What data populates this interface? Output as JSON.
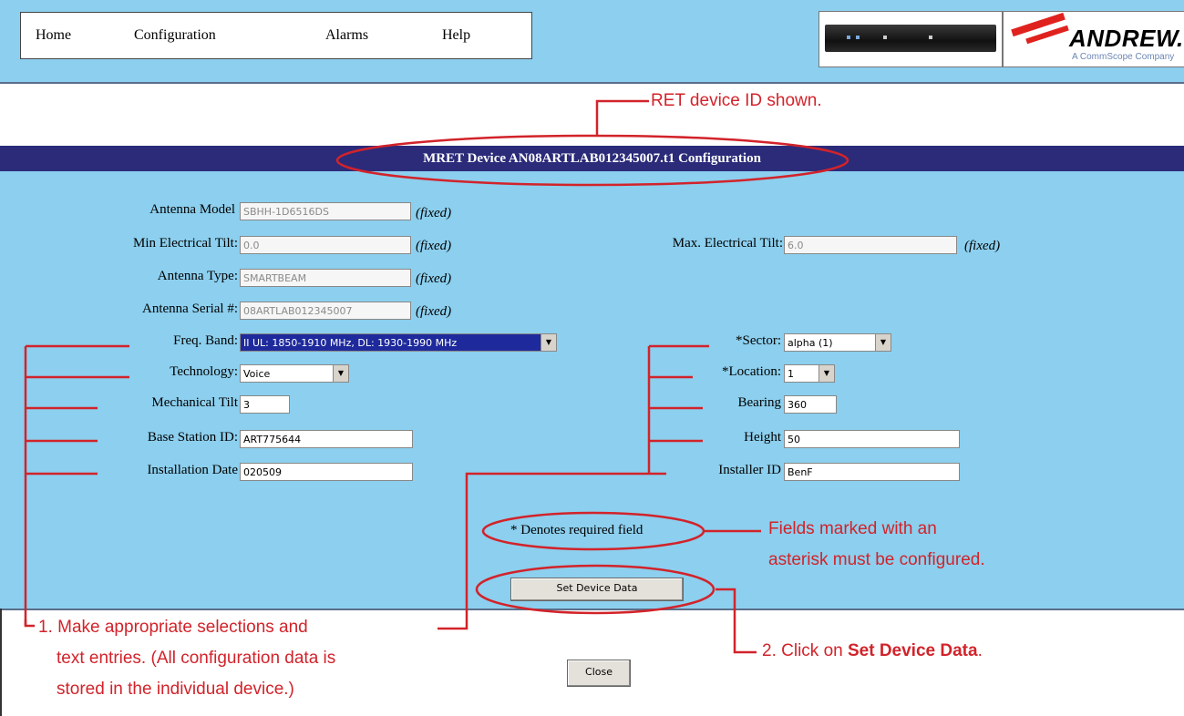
{
  "nav": {
    "home": "Home",
    "configuration": "Configuration",
    "alarms": "Alarms",
    "help": "Help"
  },
  "logo": {
    "brand": "ANDREW.",
    "tagline": "A CommScope Company"
  },
  "title": "MRET Device AN08ARTLAB012345007.t1 Configuration",
  "form": {
    "fixed_note": "(fixed)",
    "antenna_model": {
      "label": "Antenna Model",
      "value": "SBHH-1D6516DS"
    },
    "min_tilt": {
      "label": "Min Electrical Tilt:",
      "value": "0.0"
    },
    "max_tilt": {
      "label": "Max. Electrical Tilt:",
      "value": "6.0"
    },
    "antenna_type": {
      "label": "Antenna Type:",
      "value": "SMARTBEAM"
    },
    "antenna_serial": {
      "label": "Antenna Serial #:",
      "value": "08ARTLAB012345007"
    },
    "freq_band": {
      "label": "Freq. Band:",
      "value": "II UL: 1850-1910 MHz, DL: 1930-1990 MHz"
    },
    "technology": {
      "label": "Technology:",
      "value": "Voice"
    },
    "mech_tilt": {
      "label": "Mechanical Tilt",
      "value": "3"
    },
    "base_station": {
      "label": "Base Station ID:",
      "value": "ART775644"
    },
    "install_date": {
      "label": "Installation Date",
      "value": "020509"
    },
    "sector": {
      "label": "*Sector:",
      "value": "alpha (1)"
    },
    "location": {
      "label": "*Location:",
      "value": "1"
    },
    "bearing": {
      "label": "Bearing",
      "value": "360"
    },
    "height": {
      "label": "Height",
      "value": "50"
    },
    "installer": {
      "label": "Installer ID",
      "value": "BenF"
    },
    "required_note": "* Denotes required field",
    "set_button": "Set Device Data",
    "close_button": "Close"
  },
  "annotations": {
    "ret_id": "RET device ID shown.",
    "asterisk_1": "Fields marked with an",
    "asterisk_2": "asterisk must be configured.",
    "step1_1": "1. Make appropriate selections and",
    "step1_2": "text entries. (All configuration data is",
    "step1_3": "stored in the individual device.)",
    "step2_prefix": "2.  Click on ",
    "step2_bold": "Set Device Data",
    "step2_suffix": "."
  },
  "colors": {
    "panel": "#8ccfee",
    "titlebar": "#2b2b7a",
    "annotation": "#d2232a",
    "selected": "#1e2a9c"
  }
}
